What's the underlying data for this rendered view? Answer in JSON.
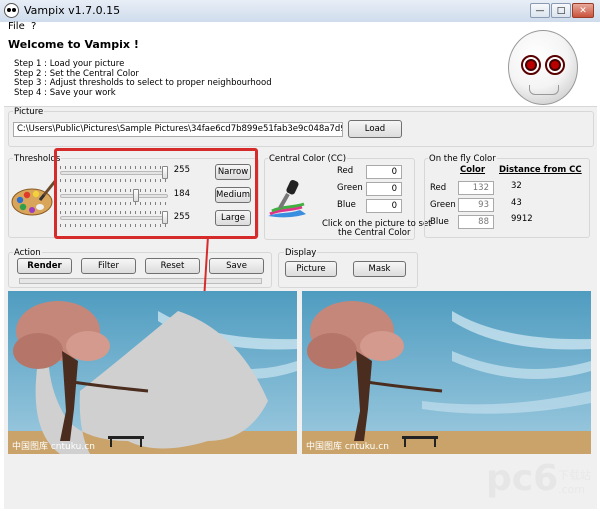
{
  "window": {
    "title": "Vampix v1.7.0.15"
  },
  "window_controls": {
    "minimize": "—",
    "maximize": "□",
    "close": "✕"
  },
  "menu": [
    "File",
    "?"
  ],
  "welcome": {
    "title": "Welcome to Vampix !",
    "steps": [
      "Step 1 : Load your picture",
      "Step 2 : Set the Central Color",
      "Step 3 : Adjust thresholds to select to proper neighbourhood",
      "Step 4 : Save your work"
    ]
  },
  "picture": {
    "label": "Picture",
    "path": "C:\\Users\\Public\\Pictures\\Sample Pictures\\34fae6cd7b899e51fab3e9c048a7d933c8950d21.jp",
    "load_button": "Load"
  },
  "thresholds": {
    "label": "Thresholds",
    "sliders": [
      {
        "value": "255",
        "level": 1.0,
        "button": "Narrow"
      },
      {
        "value": "184",
        "level": 0.72,
        "button": "Medium"
      },
      {
        "value": "255",
        "level": 1.0,
        "button": "Large"
      }
    ]
  },
  "central_color": {
    "label": "Central Color (CC)",
    "fields": [
      {
        "label": "Red",
        "value": "0"
      },
      {
        "label": "Green",
        "value": "0"
      },
      {
        "label": "Blue",
        "value": "0"
      }
    ],
    "hint_line1": "Click on the picture to set",
    "hint_line2": "the Central Color"
  },
  "on_the_fly": {
    "label": "On the fly Color",
    "col_color": "Color",
    "col_distance": "Distance from CC",
    "rows": [
      {
        "label": "Red",
        "value": "132",
        "distance": "32"
      },
      {
        "label": "Green",
        "value": "93",
        "distance": "43"
      },
      {
        "label": "Blue",
        "value": "88",
        "distance": "9912"
      }
    ]
  },
  "action": {
    "label": "Action",
    "render": "Render",
    "filter": "Filter",
    "reset": "Reset",
    "save": "Save",
    "progress": 0
  },
  "display": {
    "label": "Display",
    "picture": "Picture",
    "mask": "Mask"
  },
  "images": {
    "left_watermark": "中国图库 cntuku.cn",
    "right_watermark": "中国图库 cntuku.cn"
  },
  "site_watermark": {
    "logo": "pc6",
    "caption": "下载站",
    "url": ".com"
  },
  "colors": {
    "highlight": "#d62b2b",
    "sky": "#66a7c6",
    "ground": "#c9a36a"
  }
}
